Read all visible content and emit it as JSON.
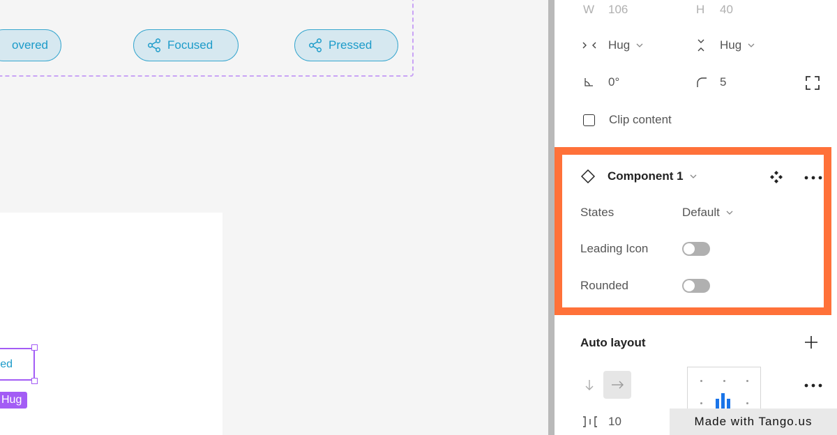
{
  "canvas": {
    "variants": [
      {
        "label": "Hovered",
        "display": "overed"
      },
      {
        "label": "Focused",
        "display": "Focused"
      },
      {
        "label": "Pressed",
        "display": "Pressed"
      }
    ],
    "selected_button_text": "ed",
    "hug_tag": "Hug"
  },
  "panel": {
    "w_label": "W",
    "w_value": "106",
    "h_label": "H",
    "h_value": "40",
    "width_sizing": "Hug",
    "height_sizing": "Hug",
    "rotation": "0°",
    "radius": "5",
    "clip_content": "Clip content",
    "component": {
      "name": "Component 1",
      "props": [
        {
          "label": "States",
          "value": "Default"
        },
        {
          "label": "Leading Icon"
        },
        {
          "label": "Rounded"
        }
      ]
    },
    "auto_layout": {
      "title": "Auto layout",
      "gap": "10"
    }
  },
  "watermark": "Made with Tango.us",
  "colors": {
    "highlight": "#ff7139",
    "selection": "#a35cf5",
    "pill_text": "#1c9bc9",
    "accent_blue": "#1a74e8"
  }
}
